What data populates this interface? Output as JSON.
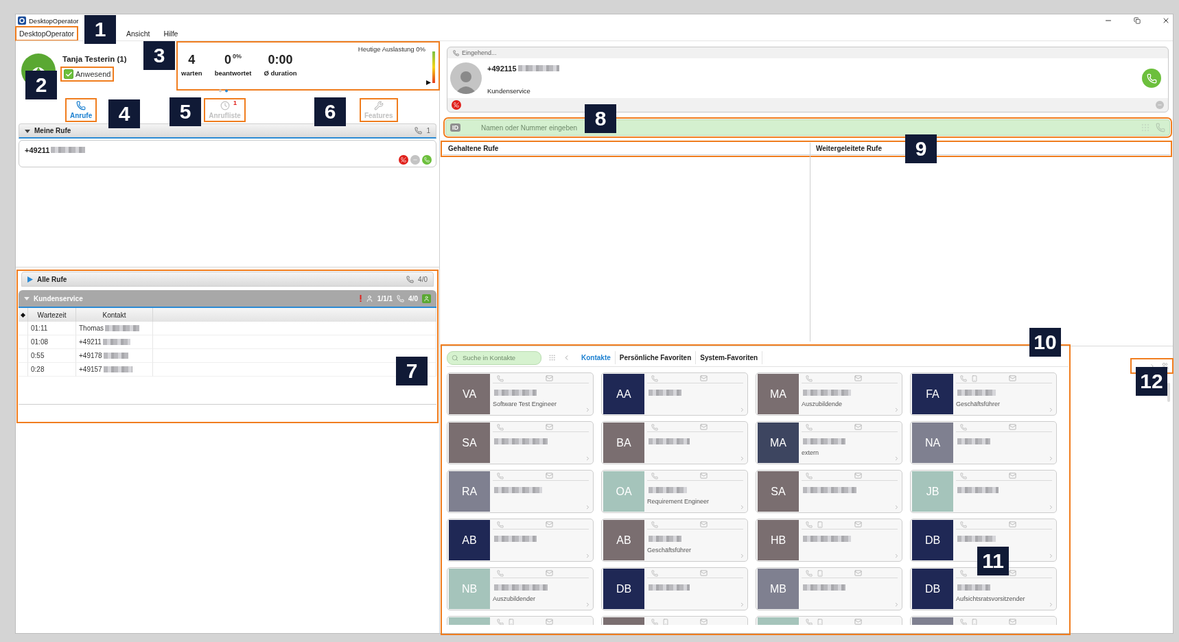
{
  "window": {
    "title": "DesktopOperator"
  },
  "menu": [
    {
      "label": "DesktopOperator",
      "highlighted": true
    },
    {
      "label": "Ansicht"
    },
    {
      "label": "Hilfe"
    }
  ],
  "agent": {
    "name": "Tanja Testerin (1)",
    "status": {
      "label": "Anwesend",
      "checked": true,
      "highlighted": true
    }
  },
  "stats": {
    "title": "Heutige Auslastung 0%",
    "level": 0,
    "highlighted": true,
    "items": [
      {
        "value": "4",
        "label": "warten"
      },
      {
        "value": "0",
        "extra": "0%",
        "label": "beantwortet"
      },
      {
        "value": "0:00",
        "label": "Ø duration"
      }
    ]
  },
  "toolbar": [
    {
      "kind": "calls",
      "label": "Anrufe",
      "selected": true,
      "highlighted": true
    },
    {
      "kind": "history",
      "label": "Anrufliste",
      "badge": "1",
      "selected": false,
      "highlighted": true
    },
    {
      "kind": "features",
      "label": "Features",
      "selected": false,
      "highlighted": true
    }
  ],
  "my_calls": {
    "title": "Meine Rufe",
    "count": "1",
    "calls": [
      {
        "number": "+49211"
      }
    ]
  },
  "queues": {
    "highlighted": true,
    "all": {
      "title": "Alle Rufe",
      "count": "4/0"
    },
    "group": {
      "title": "Kundenservice",
      "agents": "1/1/1",
      "count": "4/0",
      "columns": [
        "Wartezeit",
        "Kontakt"
      ],
      "rows": [
        {
          "wait": "01:11",
          "contact": "Thomas"
        },
        {
          "wait": "01:08",
          "contact": "+49211"
        },
        {
          "wait": "0:55",
          "contact": "+49178"
        },
        {
          "wait": "0:28",
          "contact": "+49157"
        }
      ]
    }
  },
  "incoming": {
    "label": "Eingehend...",
    "number": "+492115",
    "group": "Kundenservice"
  },
  "dial": {
    "placeholder": "Namen oder Nummer eingeben",
    "badge": "ID",
    "highlighted": true
  },
  "lists": {
    "highlighted": true,
    "held": "Gehaltene Rufe",
    "forwarded": "Weitergeleitete Rufe"
  },
  "contacts": {
    "highlighted": true,
    "search_placeholder": "Suche in Kontakte",
    "tabs": [
      {
        "label": "Kontakte",
        "selected": true
      },
      {
        "label": "Persönliche Favoriten",
        "selected": false
      },
      {
        "label": "System-Favoriten",
        "selected": false
      }
    ],
    "cards": [
      {
        "initials": "VA",
        "color": "#7a6e70",
        "role": "Software Test Engineer",
        "mobile": false
      },
      {
        "initials": "AA",
        "color": "#1f2855",
        "mobile": false
      },
      {
        "initials": "MA",
        "color": "#7a6e70",
        "role": "Auszubildende",
        "mobile": false
      },
      {
        "initials": "FA",
        "color": "#1f2855",
        "role": "Geschäftsführer",
        "mobile": true
      },
      {
        "initials": "SA",
        "color": "#7a6e70",
        "mobile": false
      },
      {
        "initials": "BA",
        "color": "#7a6e70",
        "mobile": false
      },
      {
        "initials": "MA",
        "color": "#3d4560",
        "role": "extern",
        "mobile": false
      },
      {
        "initials": "NA",
        "color": "#7f8090",
        "mobile": false
      },
      {
        "initials": "RA",
        "color": "#7f8090",
        "mobile": false
      },
      {
        "initials": "OA",
        "color": "#a5c4bb",
        "role": "Requirement Engineer",
        "mobile": false
      },
      {
        "initials": "SA",
        "color": "#7a6e70",
        "mobile": false
      },
      {
        "initials": "JB",
        "color": "#a5c4bb",
        "mobile": false
      },
      {
        "initials": "AB",
        "color": "#1f2855",
        "mobile": false
      },
      {
        "initials": "AB",
        "color": "#7a6e70",
        "role": "Geschäftsführer",
        "mobile": false
      },
      {
        "initials": "HB",
        "color": "#7a6e70",
        "mobile": true
      },
      {
        "initials": "DB",
        "color": "#1f2855",
        "mobile": false
      },
      {
        "initials": "NB",
        "color": "#a5c4bb",
        "role": "Auszubildender",
        "mobile": false
      },
      {
        "initials": "DB",
        "color": "#1f2855",
        "mobile": false
      },
      {
        "initials": "MB",
        "color": "#7f8090",
        "mobile": true
      },
      {
        "initials": "DB",
        "color": "#1f2855",
        "role": "Aufsichtsratsvorsitzender",
        "mobile": false
      },
      {
        "color": "#a5c4bb",
        "mobile": true
      },
      {
        "color": "#7a6e70",
        "mobile": true
      },
      {
        "color": "#a5c4bb",
        "mobile": true
      },
      {
        "color": "#7f8090",
        "mobile": true
      }
    ]
  },
  "side_nav": {
    "highlighted": true
  },
  "callouts": [
    "1",
    "2",
    "3",
    "4",
    "5",
    "6",
    "7",
    "8",
    "9",
    "10",
    "11",
    "12"
  ]
}
